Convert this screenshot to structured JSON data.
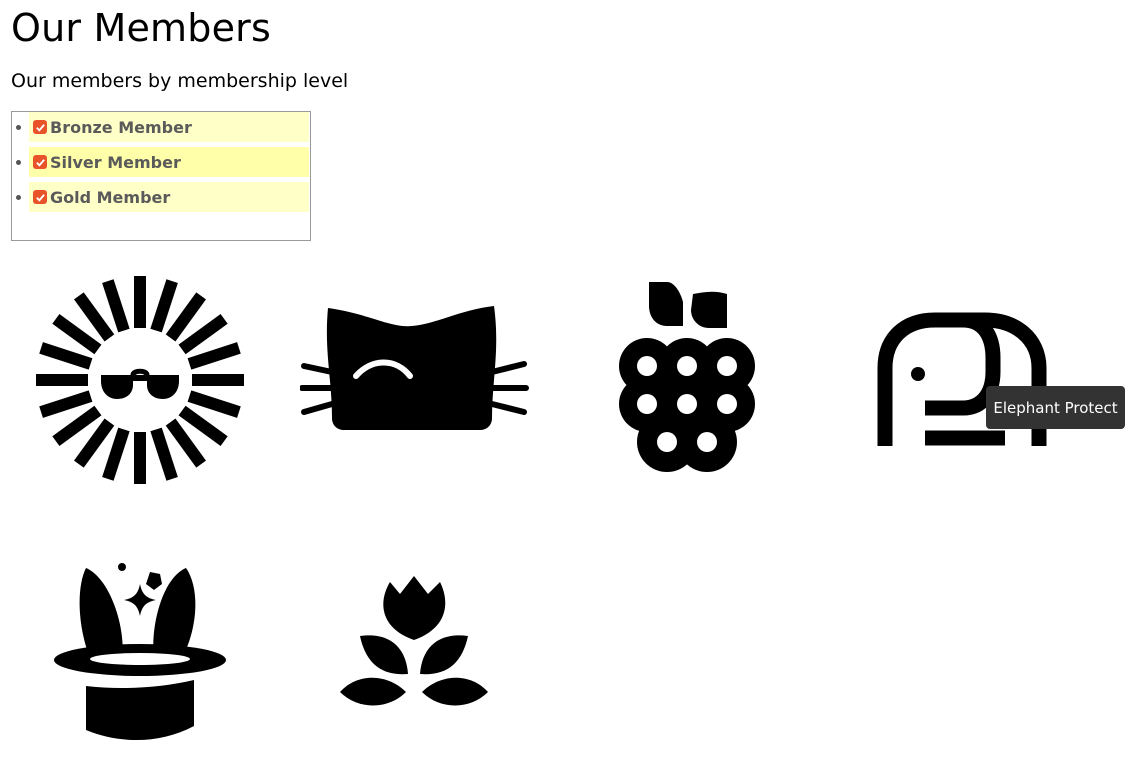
{
  "page": {
    "title": "Our Members",
    "subtitle": "Our members by membership level"
  },
  "levels": [
    {
      "label": "Bronze Member",
      "checked": true
    },
    {
      "label": "Silver Member",
      "checked": true
    },
    {
      "label": "Gold Member",
      "checked": true
    }
  ],
  "colors": {
    "checkbox": "#e8532a",
    "row_background": "#ffffc8",
    "row_highlight": "#ffffaa",
    "tooltip_background": "#333333"
  },
  "members": [
    {
      "icon": "sun-sunglasses-icon"
    },
    {
      "icon": "cat-icon"
    },
    {
      "icon": "raspberry-icon"
    },
    {
      "icon": "elephant-icon"
    },
    {
      "icon": "magic-hat-icon"
    },
    {
      "icon": "flowers-icon"
    }
  ],
  "tooltip": {
    "text": "Elephant Protect"
  }
}
